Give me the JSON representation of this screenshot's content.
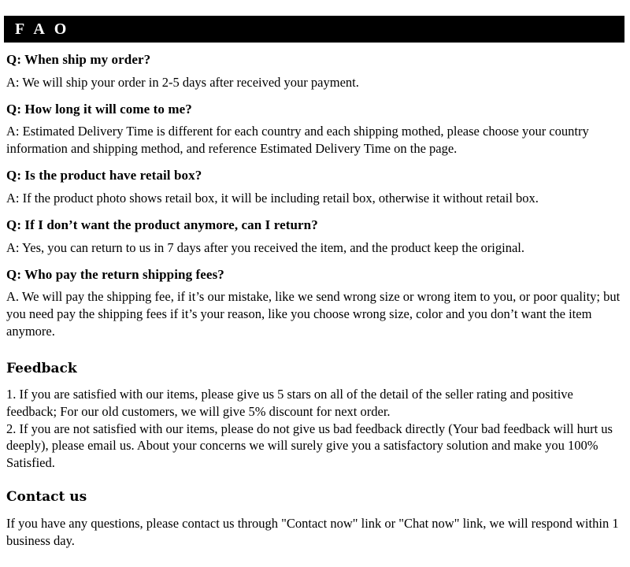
{
  "header": {
    "title": "F A O",
    "background_color": "#000000",
    "text_color": "#ffffff"
  },
  "faq": {
    "items": [
      {
        "question": "Q: When ship my order?",
        "answer": "A: We will ship your order in 2-5 days after received your payment."
      },
      {
        "question": "Q: How long it will come to me?",
        "answer": "A: Estimated Delivery Time is different for each country and each shipping mothed, please choose your country information and shipping method, and reference Estimated Delivery Time on the page."
      },
      {
        "question": "Q: Is the product have retail box?",
        "answer": "A: If  the product photo shows retail box, it will be including retail box, otherwise it without retail box."
      },
      {
        "question": "Q: If  I don’t want the product anymore, can I return?",
        "answer": "A: Yes, you can return to us in 7 days after you received the item, and the product keep the original."
      },
      {
        "question": "Q: Who pay the return shipping fees?",
        "answer": "A.  We will pay the shipping fee, if  it’s our mistake, like we send wrong size or wrong item to you, or poor quality; but you need pay the shipping fees if  it’s your reason, like you choose wrong size, color and you don’t want the item anymore."
      }
    ]
  },
  "feedback": {
    "heading": "Feedback",
    "point_1": "1.  If you are satisfied with our items, please give us 5 stars on all of the detail of the seller rating and positive feedback; For our old customers, we will give 5% discount for next order.",
    "point_2": "2.  If you are not satisfied with our items, please do not give us bad feedback directly (Your bad feedback will hurt us deeply), please email us. About your concerns we will surely give you a satisfactory solution and make you 100% Satisfied."
  },
  "contact": {
    "heading": "Contact us",
    "body": "If you have any questions, please contact us through \"Contact now\" link or \"Chat now\" link, we will respond within 1 business day."
  }
}
